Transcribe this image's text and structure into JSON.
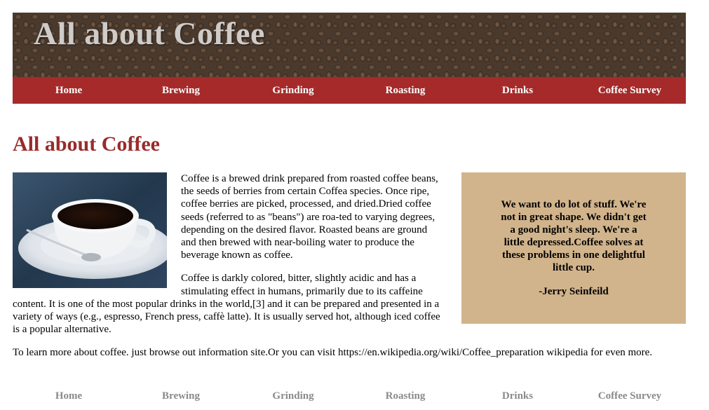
{
  "banner": {
    "title": "All about Coffee"
  },
  "nav": [
    {
      "label": "Home"
    },
    {
      "label": "Brewing"
    },
    {
      "label": "Grinding"
    },
    {
      "label": "Roasting"
    },
    {
      "label": "Drinks"
    },
    {
      "label": "Coffee Survey"
    }
  ],
  "main": {
    "title": "All about Coffee",
    "paragraph1": "Coffee is a brewed drink prepared from roasted coffee beans, the seeds of berries from certain Coffea species. Once ripe, coffee berries are picked, processed, and dried.Dried coffee seeds (referred to as \"beans\") are roa-ted to varying degrees, depending on the desired flavor. Roasted beans are ground and then brewed with near-boiling water to produce the beverage known as coffee.",
    "paragraph2": "Coffee is darkly colored, bitter, slightly acidic and has a stimulating effect in humans, primarily due to its caffeine content. It is one of the most popular drinks in the world,[3] and it can be prepared and presented in a variety of ways (e.g., espresso, French press, caffè latte). It is usually served hot, although iced coffee is a popular alternative.",
    "learn_more": "To learn more about coffee. just browse out information site.Or you can visit https://en.wikipedia.org/wiki/Coffee_preparation wikipedia for even more."
  },
  "quote": {
    "text": "We want to do lot of stuff. We're not in great shape. We didn't get a good night's sleep. We're a little depressed.Coffee solves at these problems in one delightful little cup.",
    "author": "-Jerry Seinfeild"
  },
  "footer_nav": [
    {
      "label": "Home"
    },
    {
      "label": "Brewing"
    },
    {
      "label": "Grinding"
    },
    {
      "label": "Roasting"
    },
    {
      "label": "Drinks"
    },
    {
      "label": "Coffee Survey"
    }
  ],
  "colors": {
    "nav_background": "#a62a2a",
    "title_color": "#9a2b2b",
    "quote_background": "#d2b48c",
    "footer_link": "#8a8a8a"
  }
}
